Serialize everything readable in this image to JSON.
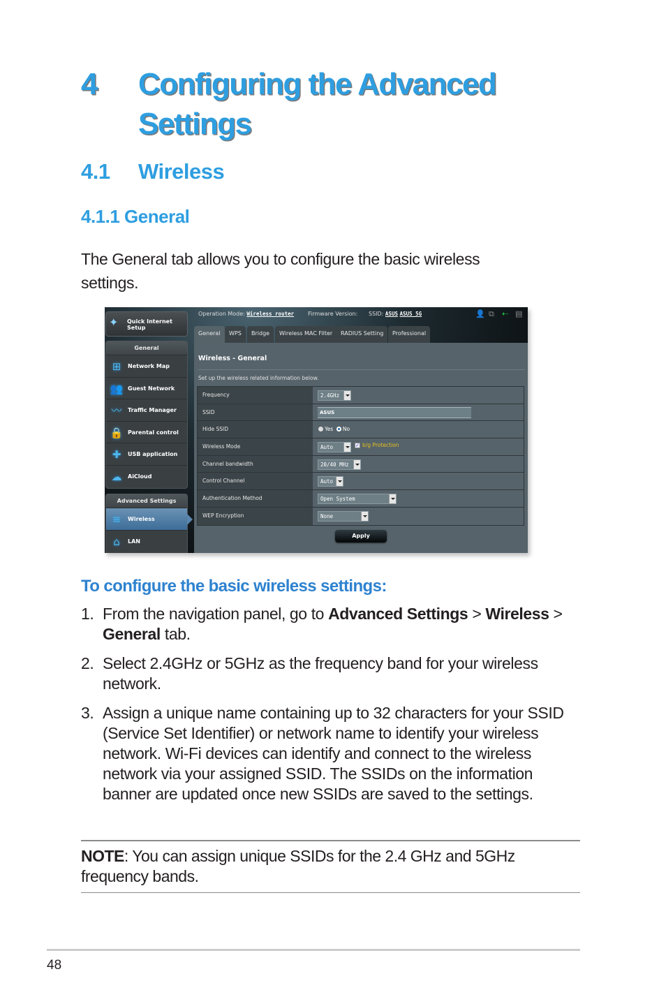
{
  "chapter": {
    "number": "4",
    "title": "Configuring the Advanced Settings"
  },
  "section": {
    "number": "4.1",
    "title": "Wireless"
  },
  "subsection": {
    "title": "4.1.1 General"
  },
  "intro": "The General tab allows you to configure the basic wireless settings.",
  "router_ui": {
    "quick_setup_label": "Quick Internet Setup",
    "nav_general_title": "General",
    "nav_general_items": [
      {
        "label": "Network Map",
        "icon": "network-map-icon"
      },
      {
        "label": "Guest Network",
        "icon": "guest-network-icon"
      },
      {
        "label": "Traffic Manager",
        "icon": "traffic-manager-icon"
      },
      {
        "label": "Parental control",
        "icon": "lock-icon"
      },
      {
        "label": "USB application",
        "icon": "puzzle-icon"
      },
      {
        "label": "AiCloud",
        "icon": "cloud-icon"
      }
    ],
    "nav_advanced_title": "Advanced Settings",
    "nav_advanced_items": [
      {
        "label": "Wireless",
        "icon": "wifi-icon",
        "active": true
      },
      {
        "label": "LAN",
        "icon": "home-icon"
      }
    ],
    "topbar": {
      "operation_mode_label": "Operation Mode:",
      "operation_mode_value": "Wireless router",
      "firmware_label": "Firmware Version:",
      "ssid_label": "SSID:",
      "ssid_values": [
        "ASUS",
        "ASUS_5G"
      ],
      "status_icons": [
        "clients-icon",
        "copy-icon",
        "usb-icon",
        "printer-icon"
      ],
      "status_colors": {
        "active": "#22cc44",
        "inactive": "#8a8a8a"
      }
    },
    "tabs": [
      "General",
      "WPS",
      "Bridge",
      "Wireless MAC Filter",
      "RADIUS Setting",
      "Professional"
    ],
    "active_tab": "General",
    "panel_title": "Wireless - General",
    "panel_desc": "Set up the wireless related information below.",
    "fields": {
      "frequency": {
        "label": "Frequency",
        "value": "2.4GHz"
      },
      "ssid": {
        "label": "SSID",
        "value": "ASUS"
      },
      "hide_ssid": {
        "label": "Hide SSID",
        "options": [
          "Yes",
          "No"
        ],
        "selected": "No"
      },
      "wireless_mode": {
        "label": "Wireless Mode",
        "value": "Auto",
        "checkbox_label": "b/g Protection",
        "checked": true
      },
      "channel_bandwidth": {
        "label": "Channel bandwidth",
        "value": "20/40 MHz"
      },
      "control_channel": {
        "label": "Control Channel",
        "value": "Auto"
      },
      "auth_method": {
        "label": "Authentication Method",
        "value": "Open System"
      },
      "wep_encryption": {
        "label": "WEP Encryption",
        "value": "None"
      }
    },
    "apply_label": "Apply"
  },
  "procedure": {
    "heading": "To configure the basic wireless settings:",
    "steps": [
      {
        "n": "1.",
        "parts": [
          "From the navigation panel, go to ",
          "Advanced Settings",
          " > ",
          "Wireless",
          " > ",
          "General",
          " tab."
        ]
      },
      {
        "n": "2.",
        "text": "Select 2.4GHz or 5GHz as the frequency band for your wireless network."
      },
      {
        "n": "3.",
        "text": "Assign a unique name containing up to 32 characters for your SSID (Service Set Identifier) or network name to identify your wireless network. Wi-Fi devices can identify and connect to the wireless network via your assigned SSID. The SSIDs on the information banner are updated once new SSIDs are saved to the settings."
      }
    ]
  },
  "note": {
    "label": "NOTE",
    "text": ":   You can assign unique SSIDs for the 2.4 GHz and 5GHz frequency bands."
  },
  "page_number": "48",
  "colors": {
    "heading_blue": "#2e9ee0",
    "subhead_blue": "#2e82cf",
    "body_text": "#231f20"
  }
}
